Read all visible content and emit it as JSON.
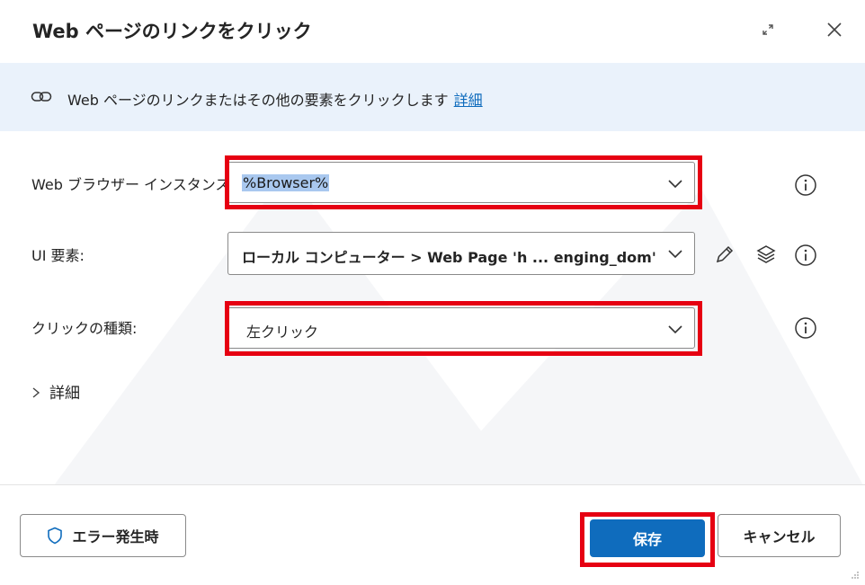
{
  "dialog": {
    "title": "Web ページのリンクをクリック",
    "icons": {
      "expand": "expand-icon",
      "close": "close-icon"
    }
  },
  "banner": {
    "icon": "link-icon",
    "text": "Web ページのリンクまたはその他の要素をクリックします",
    "link_label": "詳細"
  },
  "form": {
    "browser_instance": {
      "label": "Web ブラウザー インスタンス:",
      "value": "%Browser%",
      "icon": "chevron-down-icon"
    },
    "ui_element": {
      "label": "UI 要素:",
      "value": "ローカル コンピューター > Web Page 'h ... enging_dom' > Anc",
      "icon": "chevron-down-icon"
    },
    "click_type": {
      "label": "クリックの種類:",
      "value": "左クリック",
      "icon": "chevron-down-icon"
    },
    "advanced_label": "詳細"
  },
  "footer": {
    "on_error_label": "エラー発生時",
    "save_label": "保存",
    "cancel_label": "キャンセル"
  },
  "colors": {
    "accent": "#0f6cbd",
    "banner_bg": "#eaf2fb",
    "highlight": "#e60012"
  }
}
